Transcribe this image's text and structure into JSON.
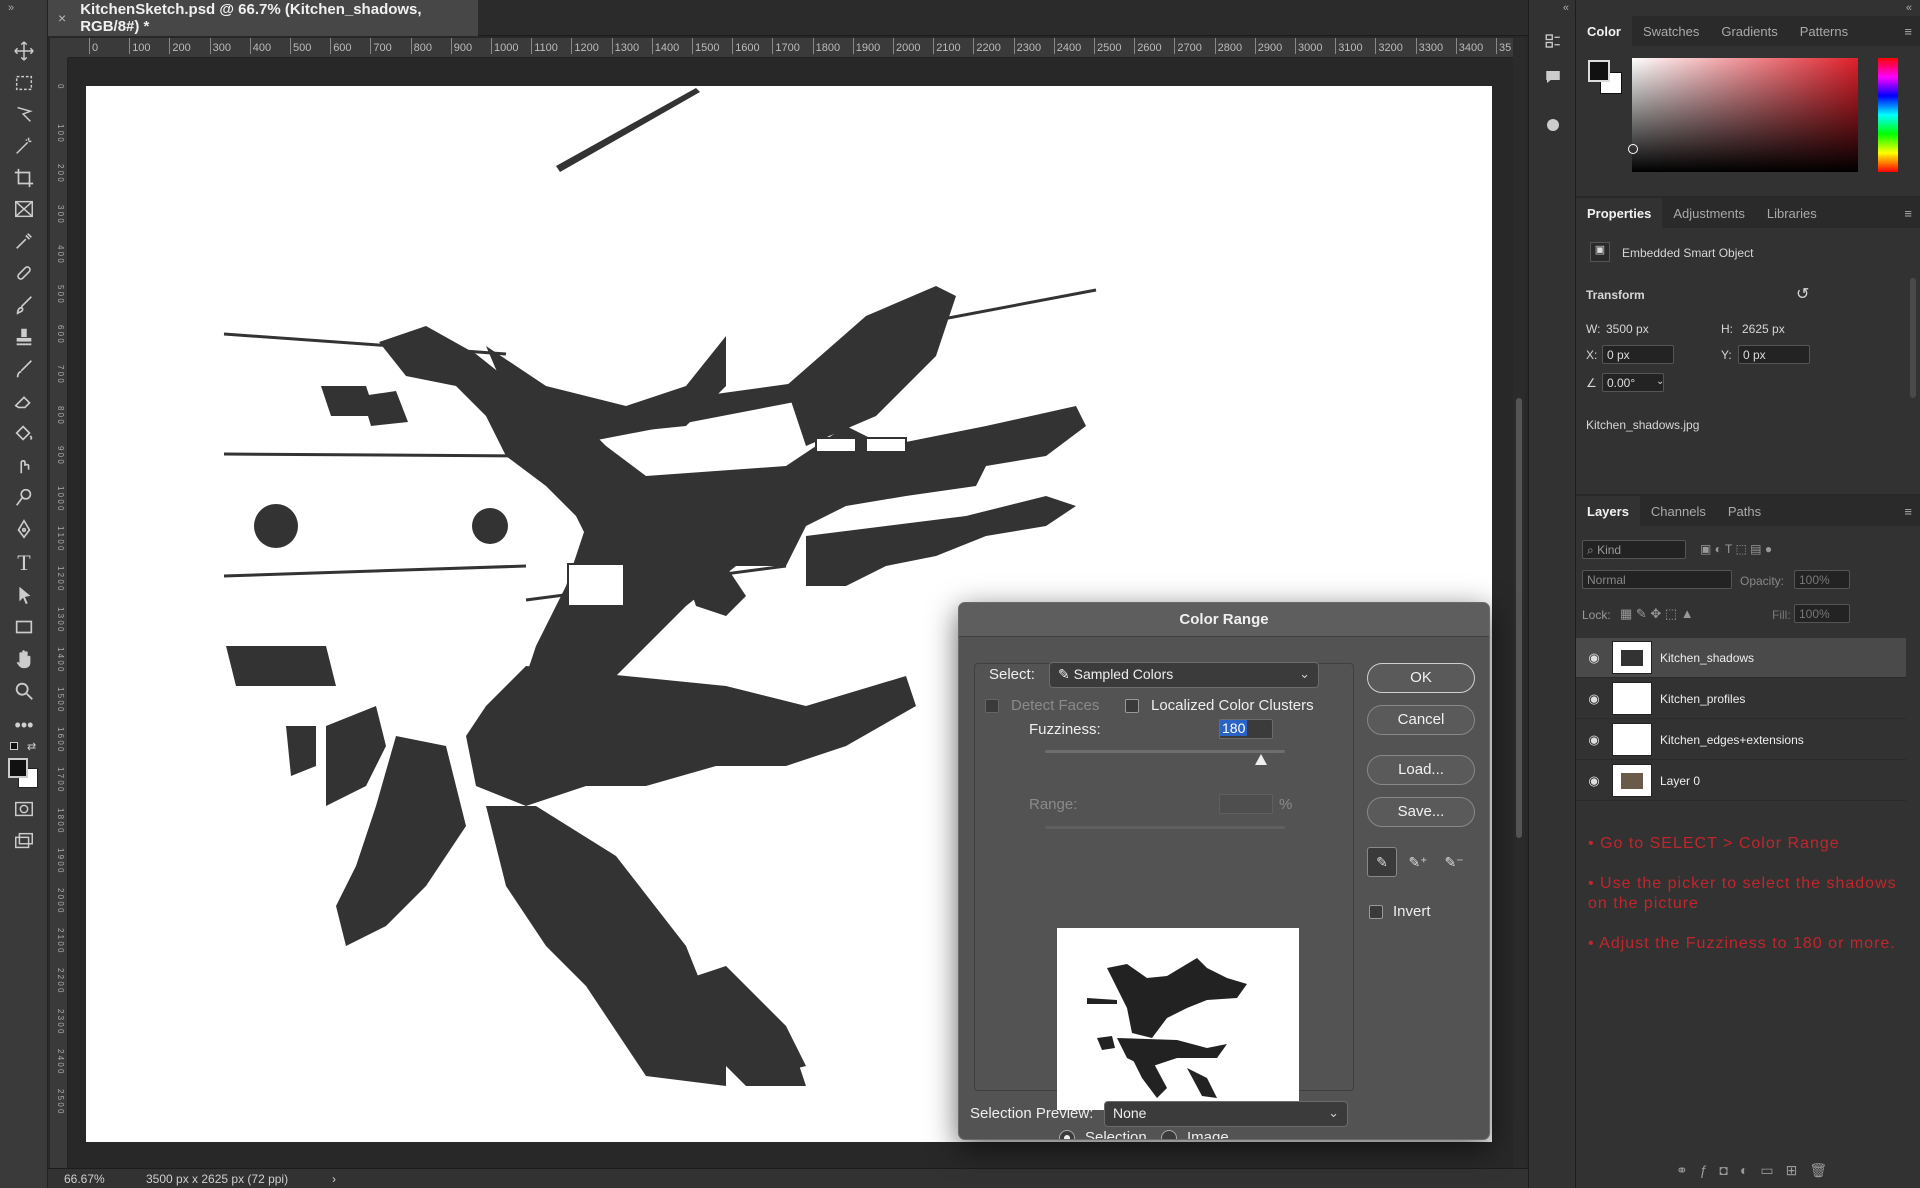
{
  "document": {
    "tab_title": "KitchenSketch.psd @ 66.7% (Kitchen_shadows, RGB/8#) *",
    "close_glyph": "×"
  },
  "ruler": {
    "h_ticks": [
      "0",
      "100",
      "200",
      "300",
      "400",
      "500",
      "600",
      "700",
      "800",
      "900",
      "1000",
      "1100",
      "1200",
      "1300",
      "1400",
      "1500",
      "1600",
      "1700",
      "1800",
      "1900",
      "2000",
      "2100",
      "2200",
      "2300",
      "2400",
      "2500",
      "2600",
      "2700",
      "2800",
      "2900",
      "3000",
      "3100",
      "3200",
      "3300",
      "3400",
      "35"
    ],
    "v_ticks": [
      "0",
      "1 0 0",
      "2 0 0",
      "3 0 0",
      "4 0 0",
      "5 0 0",
      "6 0 0",
      "7 0 0",
      "8 0 0",
      "9 0 0",
      "1 0 0 0",
      "1 1 0 0",
      "1 2 0 0",
      "1 3 0 0",
      "1 4 0 0",
      "1 5 0 0",
      "1 6 0 0",
      "1 7 0 0",
      "1 8 0 0",
      "1 9 0 0",
      "2 0 0 0",
      "2 1 0 0",
      "2 2 0 0",
      "2 3 0 0",
      "2 4 0 0",
      "2 5 0 0"
    ]
  },
  "status": {
    "zoom": "66.67%",
    "doc_info": "3500 px x 2625 px (72 ppi)",
    "arrow": "›"
  },
  "tools": [
    "move-tool",
    "marquee-tool",
    "lasso-tool",
    "magic-wand-tool",
    "crop-tool",
    "frame-tool",
    "eyedropper-tool",
    "healing-brush-tool",
    "brush-tool",
    "clone-stamp-tool",
    "history-brush-tool",
    "eraser-tool",
    "paint-bucket-tool",
    "smudge-tool",
    "dodge-tool",
    "pen-tool",
    "type-tool",
    "path-selection-tool",
    "rectangle-tool",
    "hand-tool",
    "zoom-tool",
    "more-tools"
  ],
  "color_panel": {
    "tabs": [
      "Color",
      "Swatches",
      "Gradients",
      "Patterns"
    ],
    "active": "Color"
  },
  "properties_panel": {
    "tabs": [
      "Properties",
      "Adjustments",
      "Libraries"
    ],
    "object_type": "Embedded Smart Object",
    "section": "Transform",
    "w_label": "W:",
    "w_value": "3500 px",
    "h_label": "H:",
    "h_value": "2625 px",
    "x_label": "X:",
    "x_value": "0 px",
    "y_label": "Y:",
    "y_value": "0 px",
    "angle_value": "0.00°",
    "linked_file": "Kitchen_shadows.jpg"
  },
  "layers_panel": {
    "tabs": [
      "Layers",
      "Channels",
      "Paths"
    ],
    "filter_placeholder": "Kind",
    "blend_mode": "Normal",
    "opacity_label": "Opacity:",
    "opacity_value": "100%",
    "lock_label": "Lock:",
    "fill_label": "Fill:",
    "fill_value": "100%",
    "layers": [
      {
        "name": "Kitchen_shadows",
        "selected": true
      },
      {
        "name": "Kitchen_profiles",
        "selected": false
      },
      {
        "name": "Kitchen_edges+extensions",
        "selected": false
      },
      {
        "name": "Layer 0",
        "selected": false
      }
    ],
    "notes": [
      "• Go to SELECT > Color Range",
      "• Use the picker to select the shadows on the picture",
      "• Adjust the Fuzziness to 180 or more."
    ]
  },
  "color_range_dialog": {
    "title": "Color Range",
    "select_label": "Select:",
    "select_value": "Sampled Colors",
    "detect_faces_label": "Detect Faces",
    "localized_label": "Localized Color Clusters",
    "fuzziness_label": "Fuzziness:",
    "fuzziness_value": "180",
    "range_label": "Range:",
    "range_unit": "%",
    "selection_label": "Selection",
    "image_label": "Image",
    "preview_label": "Selection Preview:",
    "preview_value": "None",
    "ok": "OK",
    "cancel": "Cancel",
    "load": "Load...",
    "save": "Save...",
    "invert_label": "Invert",
    "fuzziness_fraction": 0.9
  },
  "colors": {
    "accent_note": "#c0262c",
    "shadow_fill": "#333333"
  }
}
